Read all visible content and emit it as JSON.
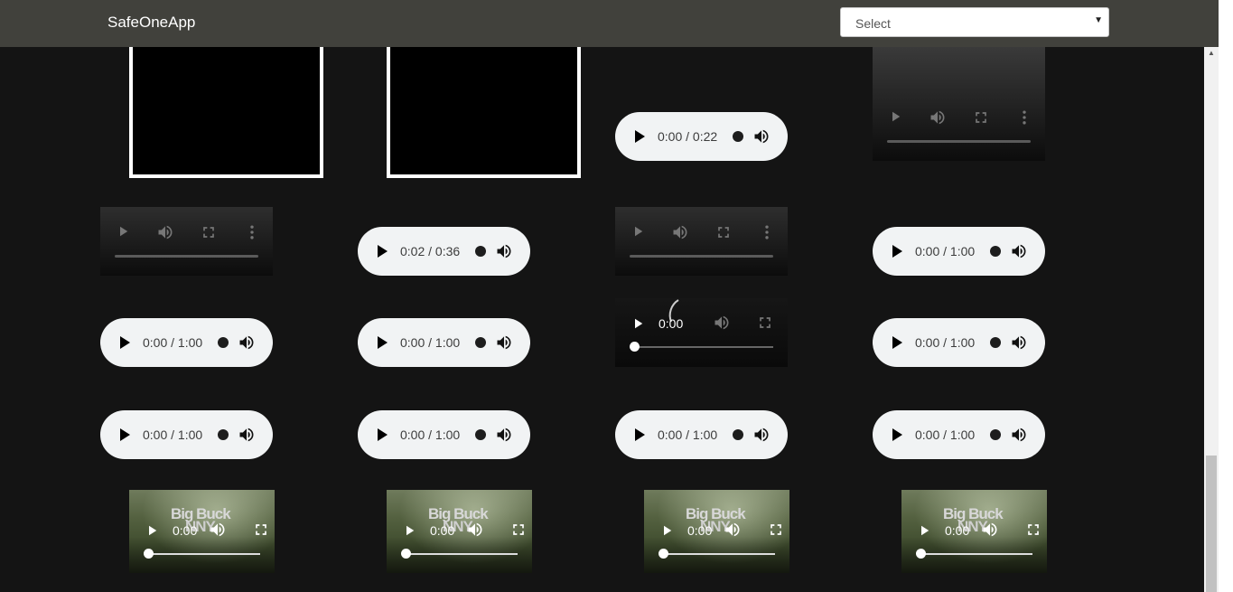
{
  "app": {
    "title": "SafeOneApp"
  },
  "select": {
    "value": "Select"
  },
  "audio_times": {
    "a1": "0:00 / 0:22",
    "a2": "0:02 / 0:36",
    "a3": "0:00 / 1:00",
    "a4": "0:00 / 1:00",
    "a5": "0:00 / 1:00",
    "a6": "0:00 / 1:00",
    "a7": "0:00 / 1:00",
    "a8": "0:00 / 1:00",
    "a9": "0:00 / 1:00",
    "a10": "0:00 / 1:00"
  },
  "video_times": {
    "loading": "0:00",
    "bbb1": "0:00",
    "bbb2": "0:00",
    "bbb3": "0:00",
    "bbb4": "0:00"
  },
  "poster": {
    "line1": "Big Buck",
    "line2": "NNY"
  },
  "colors": {
    "navbar": "#41413c",
    "background": "#141414",
    "audio_bg": "#f1f3f4"
  }
}
